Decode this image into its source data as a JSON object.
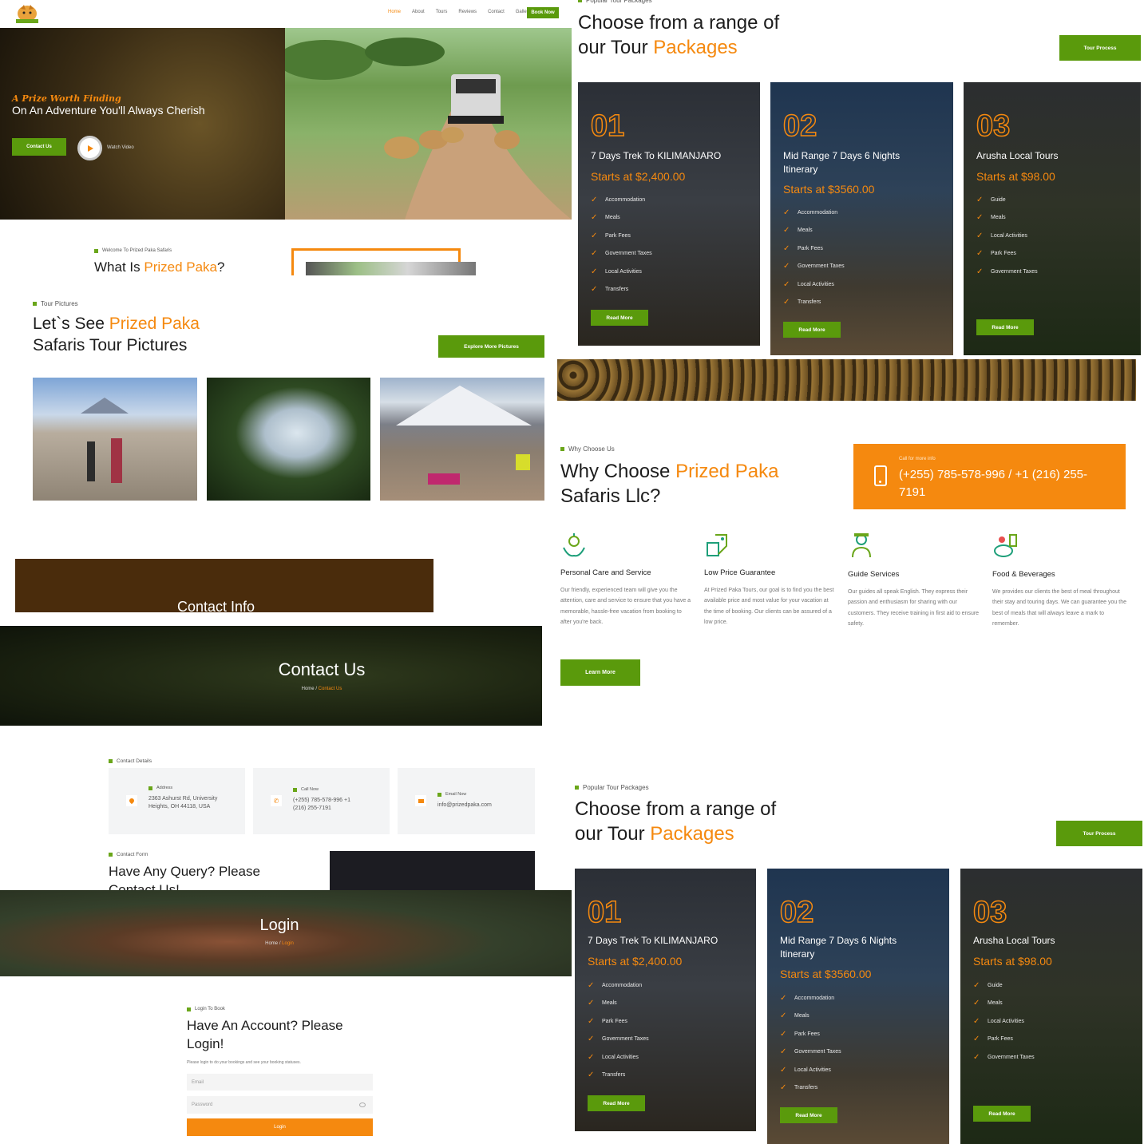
{
  "header": {
    "nav": [
      "Home",
      "About",
      "Tours",
      "Reviews",
      "Contact",
      "Gallery"
    ],
    "book_label": "Book Now"
  },
  "hero": {
    "tagline": "A Prize Worth Finding",
    "headline": "On An Adventure You'll Always Cherish",
    "contact_btn": "Contact Us",
    "watch_label": "Watch Video"
  },
  "about": {
    "tag": "Welcome To Prized Paka Safaris",
    "title_a": "What Is ",
    "title_b": "Prized Paka",
    "title_c": "?"
  },
  "pictures": {
    "tag": "Tour Pictures",
    "title_a": "Let`s See ",
    "title_b": "Prized Paka",
    "title_c": "Safaris Tour Pictures",
    "explore_btn": "Explore More Pictures"
  },
  "packages": {
    "tag": "Popular Tour Packages",
    "title_a": "Choose from a range of",
    "title_b": "our Tour ",
    "title_c": "Packages",
    "btn": "Tour Process",
    "cards": [
      {
        "num": "01",
        "title": "7 Days Trek To KILIMANJARO",
        "price": "Starts at $2,400.00",
        "items": [
          "Accommodation",
          "Meals",
          "Park Fees",
          "Government Taxes",
          "Local Activities",
          "Transfers"
        ],
        "btn": "Read More"
      },
      {
        "num": "02",
        "title": "Mid Range 7 Days 6 Nights Itinerary",
        "price": "Starts at $3560.00",
        "items": [
          "Accommodation",
          "Meals",
          "Park Fees",
          "Government Taxes",
          "Local Activities",
          "Transfers"
        ],
        "btn": "Read More"
      },
      {
        "num": "03",
        "title": "Arusha Local Tours",
        "price": "Starts at $98.00",
        "items": [
          "Guide",
          "Meals",
          "Local Activities",
          "Park Fees",
          "Government Taxes"
        ],
        "btn": "Read More"
      }
    ]
  },
  "why": {
    "tag": "Why Choose Us",
    "title_a": "Why Choose ",
    "title_b": "Prized Paka",
    "title_c": "Safaris Llc?",
    "call_label": "Call for more info",
    "phone": "(+255) 785-578-996 / +1 (216) 255-7191",
    "learn_btn": "Learn More",
    "features": [
      {
        "title": "Personal Care and Service",
        "text": "Our friendly, experienced team will give you the attention, care and service to ensure that you have a memorable, hassle-free vacation from booking to after you're back."
      },
      {
        "title": "Low Price Guarantee",
        "text": "At Prized Paka Tours, our goal is to find you the best available price and most value for your vacation at the time of booking. Our clients can be assured of a low price."
      },
      {
        "title": "Guide Services",
        "text": "Our guides all speak English. They express their passion and enthusiasm for sharing with our customers. They receive training in first aid to ensure safety."
      },
      {
        "title": "Food & Beverages",
        "text": "We provides our clients the best of meal throughout their stay and touring days. We can guarantee you the best of meals that will always leave a mark to remember."
      }
    ]
  },
  "contact_info": {
    "title": "Contact Info"
  },
  "contact_us": {
    "title": "Contact Us",
    "crumb_home": "Home",
    "crumb_sep": " / ",
    "crumb_current": "Contact Us"
  },
  "contact_details": {
    "tag": "Contact Details",
    "cards": [
      {
        "label": "Address",
        "value": "2363 Ashurst Rd, University Heights, OH 44118, USA"
      },
      {
        "label": "Call Now",
        "value": "(+255) 785-578-996 +1 (216) 255-7191"
      },
      {
        "label": "Email Now",
        "value": "info@prizedpaka.com"
      }
    ],
    "form_tag": "Contact Form",
    "form_title": "Have Any Query? Please Contact Us!"
  },
  "login": {
    "title": "Login",
    "crumb_home": "Home",
    "crumb_sep": " / ",
    "crumb_current": "Login",
    "tag": "Login To Book",
    "heading": "Have An Account? Please Login!",
    "sub": "Please login to do your bookings and see your booking statuses.",
    "email_placeholder": "Email",
    "password_placeholder": "Password",
    "btn": "Login"
  },
  "colors": {
    "accent": "#f5890f",
    "brand_green": "#5a9a0c"
  }
}
